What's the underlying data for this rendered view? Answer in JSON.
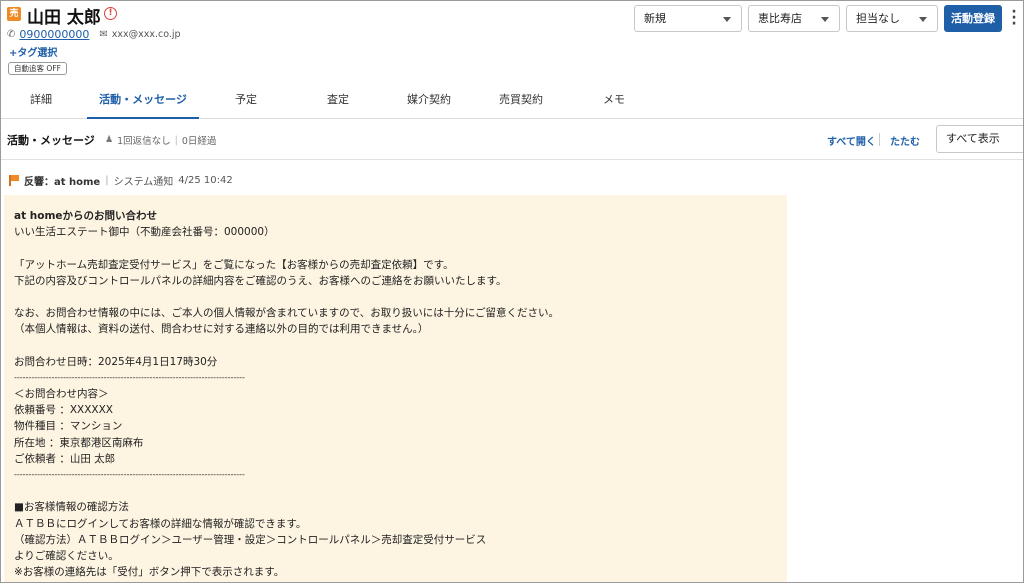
{
  "header": {
    "badge": "売",
    "customer_name": "山田 太郎",
    "alert": "!",
    "phone": "0900000000",
    "email": "xxx@xxx.co.jp",
    "tag_select": "+タグ選択",
    "auto_follow": "自動追客 OFF",
    "status_select": "新規",
    "store_select": "恵比寿店",
    "staff_select": "担当なし",
    "register_button": "活動登録",
    "more": "⋮"
  },
  "tabs": [
    {
      "label": "詳細",
      "active": false
    },
    {
      "label": "活動・メッセージ",
      "active": true
    },
    {
      "label": "予定",
      "active": false
    },
    {
      "label": "査定",
      "active": false
    },
    {
      "label": "媒介契約",
      "active": false
    },
    {
      "label": "売買契約",
      "active": false
    },
    {
      "label": "メモ",
      "active": false
    }
  ],
  "section": {
    "title": "活動・メッセージ",
    "reply_status": "1回返信なし",
    "elapsed": "0日経過",
    "expand_all": "すべて開く",
    "collapse": "たたむ",
    "show_select": "すべて表示"
  },
  "message": {
    "type": "反響",
    "source": "：at home",
    "separator": "|",
    "kind": "システム通知",
    "datetime": "4/25 10:42",
    "lines": [
      "at homeからのお問い合わせ",
      "いい生活エステート御中（不動産会社番号：000000）",
      "",
      "「アットホーム売却査定受付サービス」をご覧になった【お客様からの売却査定依頼】です。",
      "下記の内容及びコントロールパネルの詳細内容をご確認のうえ、お客様へのご連絡をお願いいたします。",
      "",
      "なお、お問合わせ情報の中には、ご本人の個人情報が含まれていますので、お取り扱いには十分にご留意ください。",
      "（本個人情報は、資料の送付、問合わせに対する連絡以外の目的では利用できません。）",
      "",
      "お問合わせ日時：2025年4月1日17時30分",
      "--------------------------------------------------------------------------------",
      "＜お問合わせ内容＞",
      "依頼番号 ：XXXXXX",
      "物件種目 ：マンション",
      "所在地 ：東京都港区南麻布",
      "ご依頼者 ：山田 太郎",
      "--------------------------------------------------------------------------------",
      "",
      "■お客様情報の確認方法",
      "ＡＴＢＢにログインしてお客様の詳細な情報が確認できます。",
      "（確認方法）ＡＴＢＢログイン＞ユーザー管理・設定＞コントロールパネル＞売却査定受付サービス",
      "よりご確認ください。",
      "※お客様の連絡先は「受付」ボタン押下で表示されます。"
    ]
  }
}
